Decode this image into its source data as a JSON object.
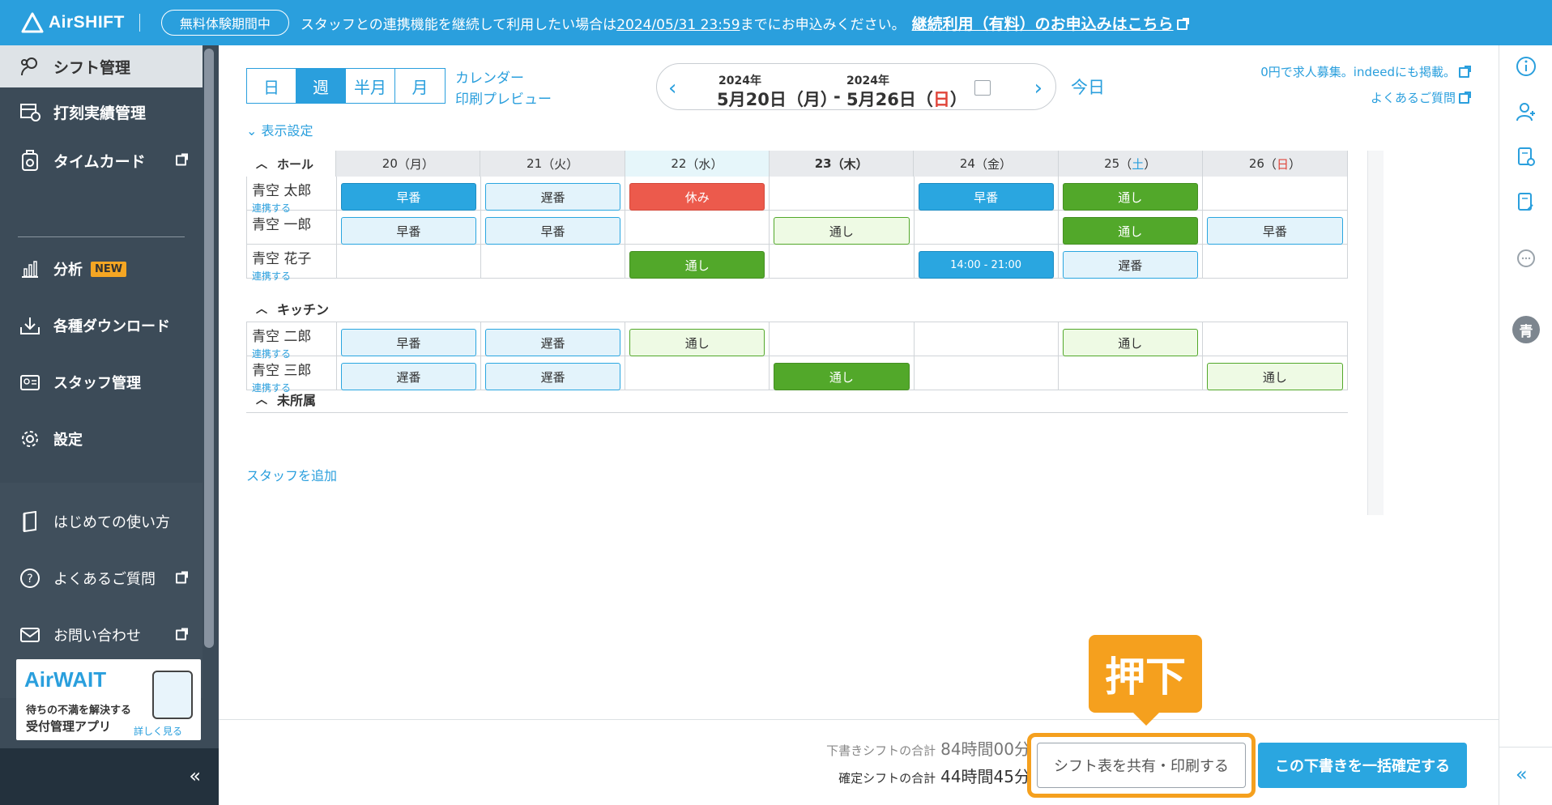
{
  "banner": {
    "logo": "AirSHIFT",
    "trial_pill": "無料体験期間中",
    "message_prefix": "スタッフとの連携機能を継続して利用したい場合は",
    "deadline": "2024/05/31 23:59",
    "message_suffix": "までにお申込みください。",
    "cta": "継続利用（有料）のお申込みはこちら"
  },
  "sidebar": {
    "items": [
      {
        "label": "シフト管理",
        "icon": "calendar-person-icon"
      },
      {
        "label": "打刻実績管理",
        "icon": "table-clock-icon"
      },
      {
        "label": "タイムカード",
        "icon": "timecard-icon"
      },
      {
        "label": "分析",
        "icon": "bar-chart-icon",
        "badge": "NEW"
      },
      {
        "label": "各種ダウンロード",
        "icon": "download-icon"
      },
      {
        "label": "スタッフ管理",
        "icon": "id-card-icon"
      },
      {
        "label": "設定",
        "icon": "gear-icon"
      },
      {
        "label": "はじめての使い方",
        "icon": "book-icon"
      },
      {
        "label": "よくあるご質問",
        "icon": "question-icon"
      },
      {
        "label": "お問い合わせ",
        "icon": "mail-icon"
      }
    ],
    "ad": {
      "logo": "AirWAIT",
      "subtitle": "待ちの不満を解決する",
      "app": "受付管理アプリ",
      "link": "詳しく見る"
    },
    "collapse": "«"
  },
  "toolbar": {
    "view_tabs": [
      "日",
      "週",
      "半月",
      "月"
    ],
    "selected_view": "週",
    "calendar_link": "カレンダー",
    "print_preview": "印刷プレビュー",
    "start_year": "2024年",
    "start_date": "5月20日（月）",
    "range_sep": "-",
    "end_year": "2024年",
    "end_date_prefix": "5月26日（",
    "end_date_day": "日",
    "end_date_suffix": "）",
    "today": "今日",
    "recruit_link": "0円で求人募集。indeedにも掲載。",
    "faq_link": "よくあるご質問",
    "display_settings": "表示設定"
  },
  "table": {
    "days": [
      {
        "num": "20",
        "day": "月"
      },
      {
        "num": "21",
        "day": "火"
      },
      {
        "num": "22",
        "day": "水"
      },
      {
        "num": "23",
        "day": "木"
      },
      {
        "num": "24",
        "day": "金"
      },
      {
        "num": "25",
        "day": "土"
      },
      {
        "num": "26",
        "day": "日"
      }
    ],
    "groups": [
      {
        "name": "ホール"
      },
      {
        "name": "キッチン"
      },
      {
        "name": "未所属"
      }
    ],
    "staff": [
      {
        "name": "青空 太郎",
        "link": "連携する",
        "shifts": [
          "早番",
          "遅番",
          "休み",
          "",
          "早番",
          "通し",
          ""
        ]
      },
      {
        "name": "青空 一郎",
        "link": "",
        "shifts": [
          "早番",
          "早番",
          "",
          "通し",
          "",
          "通し",
          "早番"
        ]
      },
      {
        "name": "青空 花子",
        "link": "連携する",
        "shifts": [
          "",
          "",
          "通し",
          "",
          "14:00 - 21:00",
          "遅番",
          ""
        ]
      },
      {
        "name": "青空 二郎",
        "link": "連携する",
        "shifts": [
          "早番",
          "遅番",
          "通し",
          "",
          "",
          "通し",
          ""
        ]
      },
      {
        "name": "青空 三郎",
        "link": "連携する",
        "shifts": [
          "遅番",
          "遅番",
          "",
          "通し",
          "",
          "",
          "通し"
        ]
      }
    ],
    "add_staff": "スタッフを追加"
  },
  "footer": {
    "draft_label": "下書きシフトの合計",
    "draft_value": "84時間00分",
    "confirmed_label": "確定シフトの合計",
    "confirmed_value": "44時間45分",
    "share_button": "シフト表を共有・印刷する",
    "confirm_button": "この下書きを一括確定する"
  },
  "annotation": {
    "callout": "押下",
    "color": "#f5a01e"
  },
  "rightrail": {
    "avatar": "青",
    "collapse": "«"
  },
  "colors": {
    "primary": "#2a9fdd",
    "sidebar": "#3c4b58",
    "green": "#52a82a",
    "red": "#ec5a4c"
  }
}
